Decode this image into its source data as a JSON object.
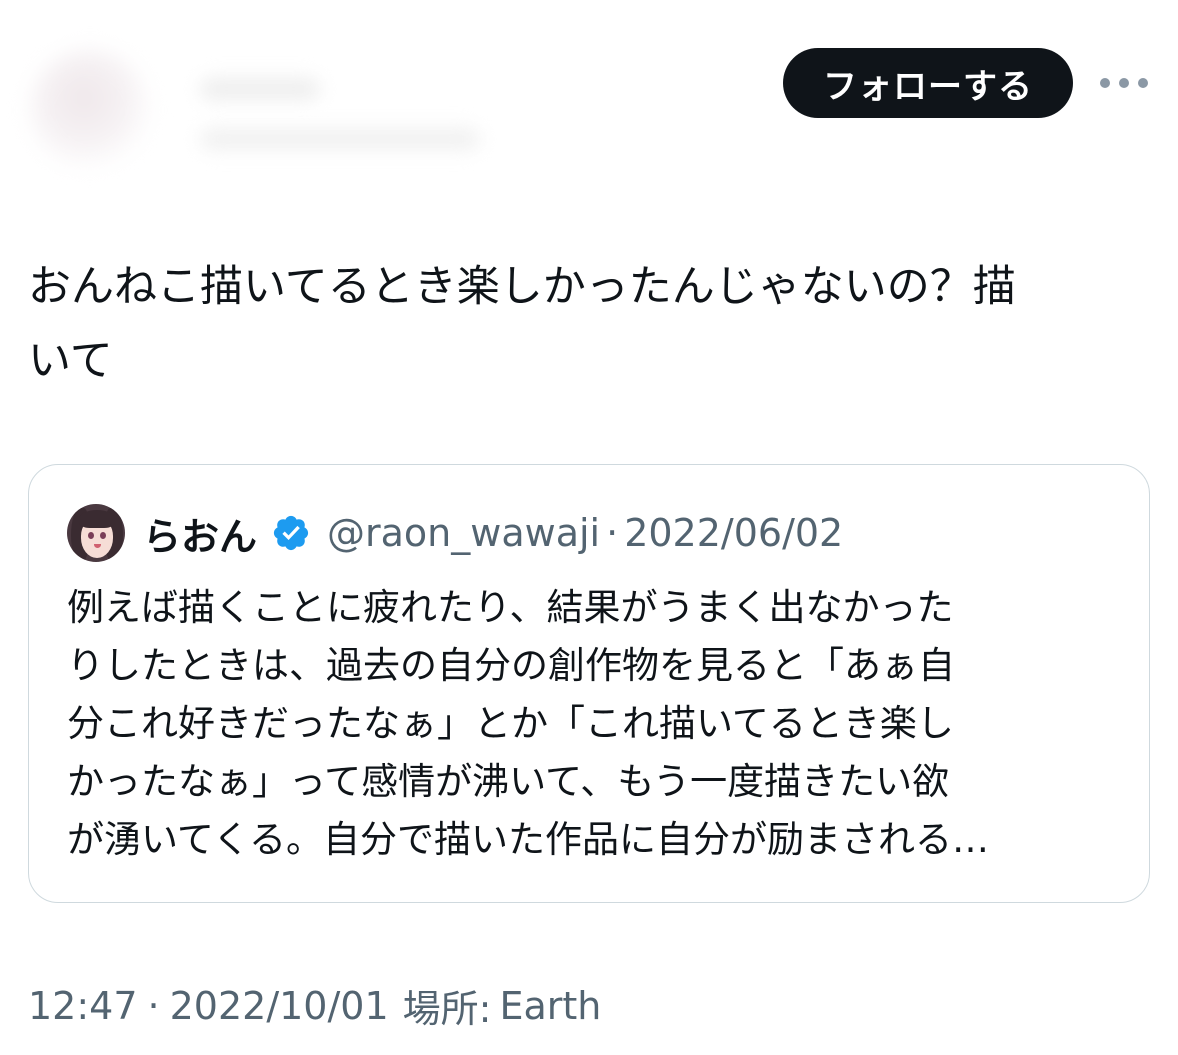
{
  "header": {
    "follow_label": "フォローする",
    "more_icon": "more-horizontal-icon"
  },
  "tweet": {
    "text": "おんねこ描いてるとき楽しかったんじゃないの？描\nいて"
  },
  "quote": {
    "author_name": "らおん",
    "verified_icon": "verified-badge-icon",
    "handle": "@raon_wawaji",
    "separator": "·",
    "date": "2022/06/02",
    "text": "例えば描くことに疲れたり、結果がうまく出なかった\nりしたときは、過去の自分の創作物を見ると「あぁ自\n分これ好きだったなぁ」とか「これ描いてるとき楽し\nかったなぁ」って感情が沸いて、もう一度描きたい欲\nが湧いてくる。自分で描いた作品に自分が励まされる…"
  },
  "meta": {
    "time": "12:47",
    "separator": "·",
    "date": "2022/10/01",
    "location_label": "場所:",
    "location_value": "Earth"
  },
  "colors": {
    "text_primary": "#0f1419",
    "text_secondary": "#536471",
    "border": "#cfd9de",
    "verified_blue": "#1d9bf0",
    "follow_button_bg": "#0f1419"
  }
}
